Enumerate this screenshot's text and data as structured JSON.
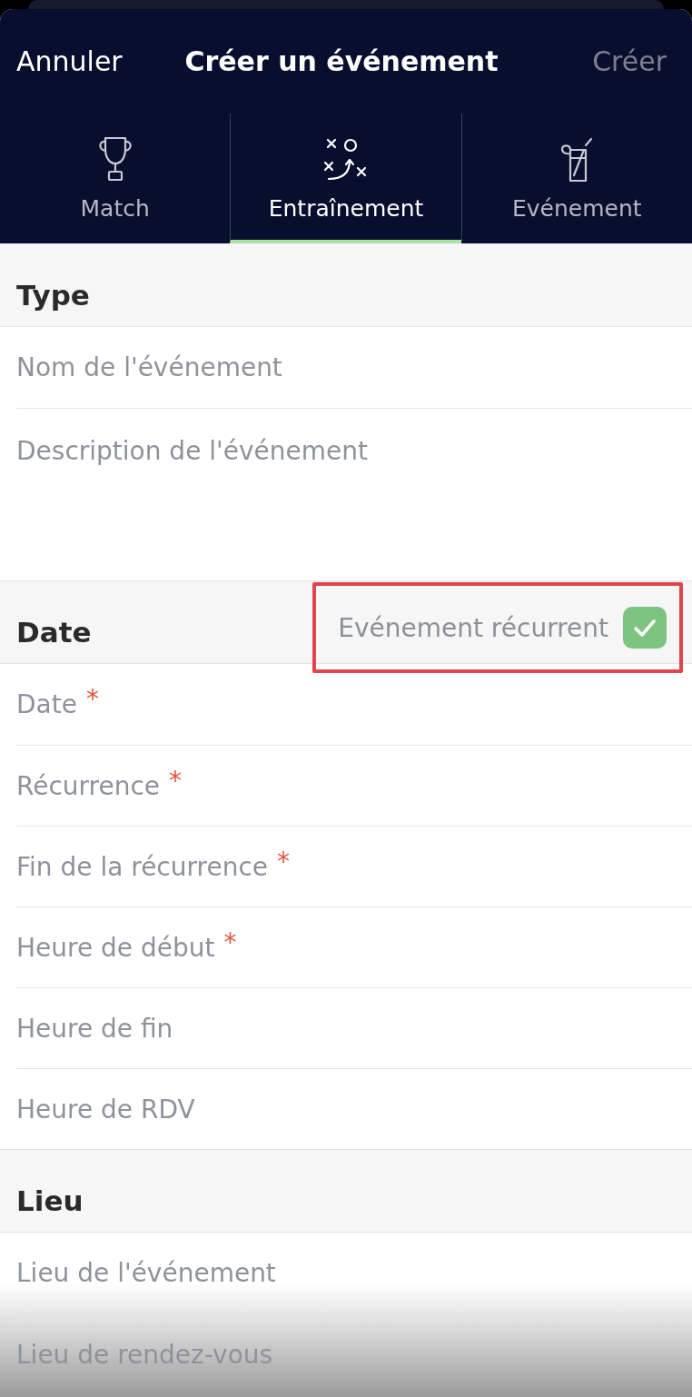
{
  "header": {
    "cancel": "Annuler",
    "title": "Créer un événement",
    "create": {
      "label": "Créer",
      "disabled": true
    }
  },
  "tabs": [
    {
      "label": "Match",
      "selected": false
    },
    {
      "label": "Entraînement",
      "selected": true
    },
    {
      "label": "Evénement",
      "selected": false
    }
  ],
  "sections": [
    {
      "title": "Type",
      "fields": [
        {
          "kind": "text",
          "placeholder": "Nom de l'événement"
        },
        {
          "kind": "textarea",
          "placeholder": "Description de l'événement"
        }
      ]
    },
    {
      "title": "Date",
      "toggle": {
        "label": "Evénement récurrent",
        "checked": true,
        "highlighted": true
      },
      "fields": [
        {
          "kind": "picker",
          "placeholder": "Date",
          "required_mark": "*"
        },
        {
          "kind": "picker",
          "placeholder": "Récurrence",
          "required_mark": "*"
        },
        {
          "kind": "picker",
          "placeholder": "Fin de la récurrence",
          "required_mark": "*"
        },
        {
          "kind": "picker",
          "placeholder": "Heure de début",
          "required_mark": "*"
        },
        {
          "kind": "picker",
          "placeholder": "Heure de fin"
        },
        {
          "kind": "picker",
          "placeholder": "Heure de RDV"
        }
      ]
    },
    {
      "title": "Lieu",
      "fields": [
        {
          "kind": "text",
          "placeholder": "Lieu de l'événement"
        },
        {
          "kind": "text",
          "placeholder": "Lieu de rendez-vous"
        }
      ]
    }
  ]
}
